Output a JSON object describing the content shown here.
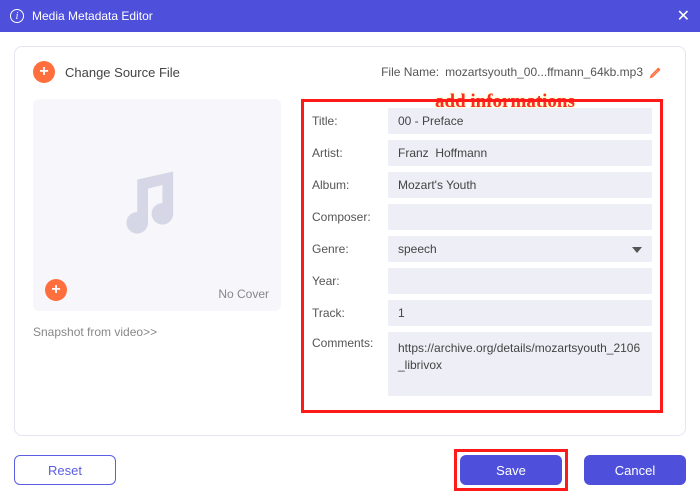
{
  "titlebar": {
    "title": "Media Metadata Editor"
  },
  "top": {
    "change_source": "Change Source File",
    "file_name_label": "File Name:",
    "file_name_value": "mozartsyouth_00...ffmann_64kb.mp3"
  },
  "annotation": "add informations",
  "cover": {
    "no_cover": "No Cover",
    "snapshot": "Snapshot from video>>"
  },
  "form": {
    "title_label": "Title:",
    "title_value": "00 - Preface",
    "artist_label": "Artist:",
    "artist_value": "Franz  Hoffmann",
    "album_label": "Album:",
    "album_value": "Mozart's Youth",
    "composer_label": "Composer:",
    "composer_value": "",
    "genre_label": "Genre:",
    "genre_value": "speech",
    "year_label": "Year:",
    "year_value": "",
    "track_label": "Track:",
    "track_value": "1",
    "comments_label": "Comments:",
    "comments_value": "https://archive.org/details/mozartsyouth_2106_librivox"
  },
  "footer": {
    "reset": "Reset",
    "save": "Save",
    "cancel": "Cancel"
  }
}
